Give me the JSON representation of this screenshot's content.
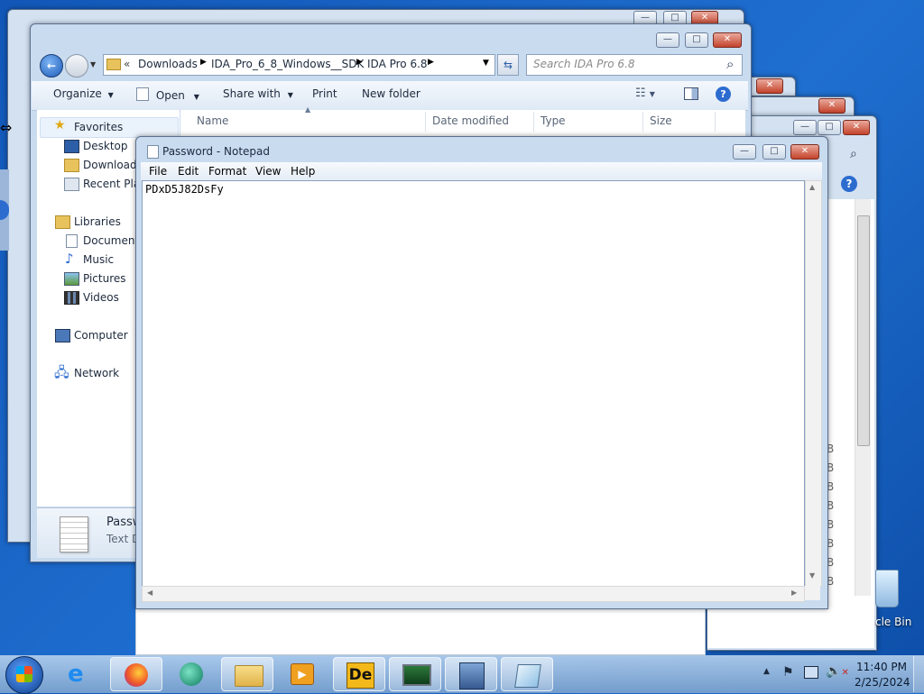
{
  "explorer": {
    "breadcrumb": {
      "prefix": "«",
      "parts": [
        "Downloads",
        "IDA_Pro_6_8_Windows__SDK",
        "IDA Pro 6.8"
      ]
    },
    "search_placeholder": "Search IDA Pro 6.8",
    "toolbar": {
      "organize": "Organize",
      "open": "Open",
      "share_with": "Share with",
      "print": "Print",
      "new_folder": "New folder"
    },
    "columns": {
      "name": "Name",
      "date_modified": "Date modified",
      "type": "Type",
      "size": "Size"
    },
    "nav": {
      "favorites": "Favorites",
      "desktop": "Desktop",
      "downloads": "Downloads",
      "recent": "Recent Plac",
      "libraries": "Libraries",
      "documents": "Documents",
      "music": "Music",
      "pictures": "Pictures",
      "videos": "Videos",
      "computer": "Computer",
      "network": "Network"
    },
    "details": {
      "filename": "Passw",
      "filetype": "Text D"
    }
  },
  "background_window": {
    "size_cells": [
      "B",
      "B",
      "B",
      "B",
      "B",
      "B",
      "B",
      "B"
    ]
  },
  "notepad": {
    "title": "Password - Notepad",
    "menu": [
      "File",
      "Edit",
      "Format",
      "View",
      "Help"
    ],
    "content": "PDxD5J82DsFy"
  },
  "desktop": {
    "recycle_bin_label": "cle Bin"
  },
  "taskbar": {
    "clock_time": "11:40 PM",
    "clock_date": "2/25/2024"
  }
}
